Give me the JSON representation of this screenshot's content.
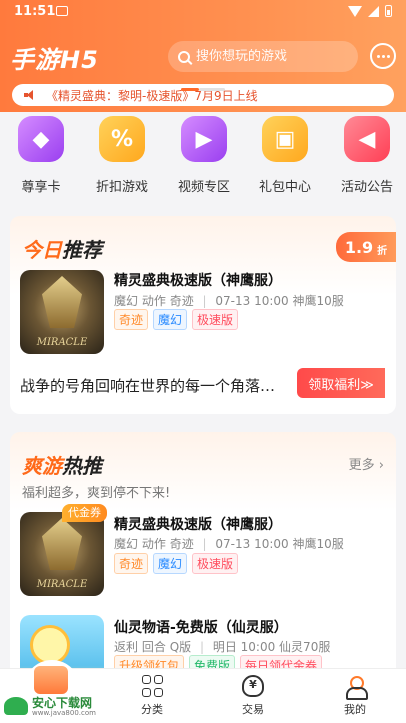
{
  "status_bar": {
    "time": "11:51"
  },
  "header": {
    "logo": "手游H5",
    "search_placeholder": "搜你想玩的游戏"
  },
  "notice": {
    "text": "《精灵盛典：黎明-极速版》7月9日上线"
  },
  "categories": [
    {
      "label": "尊享卡",
      "icon": "diamond-card-icon",
      "color": "#b35cf5"
    },
    {
      "label": "折扣游戏",
      "icon": "discount-tag-icon",
      "color": "#ffb52e"
    },
    {
      "label": "视频专区",
      "icon": "tv-icon",
      "color": "#b35cf5"
    },
    {
      "label": "礼包中心",
      "icon": "gift-icon",
      "color": "#ffb52e"
    },
    {
      "label": "活动公告",
      "icon": "megaphone-icon",
      "color": "#ff5a6a"
    }
  ],
  "today": {
    "title_hl": "今日",
    "title_rest": "推荐",
    "discount_value": "1.9",
    "discount_unit": "折",
    "game": {
      "name": "精灵盛典极速版（神鹰服）",
      "genres": [
        "魔幻",
        "动作",
        "奇迹"
      ],
      "schedule": "07-13 10:00 神鹰10服",
      "tags": [
        "奇迹",
        "魔幻",
        "极速版"
      ]
    },
    "slogan": "战争的号角回响在世界的每一个角落…",
    "claim_button": "领取福利≫"
  },
  "hot": {
    "title_hl": "爽游",
    "title_rest": "热推",
    "more": "更多 ›",
    "subtitle": "福利超多，爽到停不下来!",
    "games": [
      {
        "name": "精灵盛典极速版（神鹰服）",
        "coupon_tag": "代金券",
        "genres": [
          "魔幻",
          "动作",
          "奇迹"
        ],
        "schedule": "07-13 10:00 神鹰10服",
        "tags": [
          "奇迹",
          "魔幻",
          "极速版"
        ]
      },
      {
        "name": "仙灵物语-免费版（仙灵服）",
        "genres": [
          "返利",
          "回合",
          "Q版"
        ],
        "schedule": "明日 10:00 仙灵70服",
        "tags": [
          "升级领红包",
          "免费版",
          "每日领代金券"
        ]
      }
    ]
  },
  "tabbar": {
    "items": [
      "分类",
      "交易",
      "我的"
    ]
  },
  "watermark": {
    "text": "安心下载网",
    "url": "www.java800.com"
  }
}
